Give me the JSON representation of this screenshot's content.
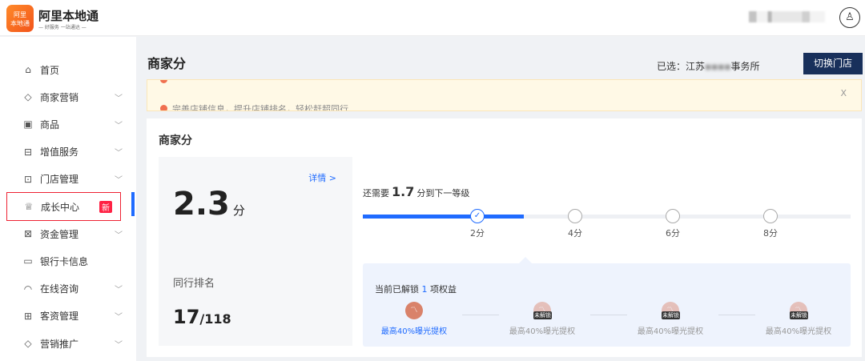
{
  "header": {
    "logo_text": "阿里本地通",
    "brand": "阿里本地通",
    "slogan": "— 好服务 一站通达 —",
    "avatar_icon": "user-icon"
  },
  "sidebar": {
    "items": [
      {
        "label": "首页",
        "icon": "⌂",
        "chev": ""
      },
      {
        "label": "商家营销",
        "icon": "◇",
        "chev": "﹀"
      },
      {
        "label": "商品",
        "icon": "▣",
        "chev": "﹀"
      },
      {
        "label": "增值服务",
        "icon": "⊟",
        "chev": "﹀"
      },
      {
        "label": "门店管理",
        "icon": "⊡",
        "chev": "﹀"
      },
      {
        "label": "成长中心",
        "icon": "♕",
        "chev": "",
        "badge": "新"
      },
      {
        "label": "资金管理",
        "icon": "⊠",
        "chev": "﹀"
      },
      {
        "label": "银行卡信息",
        "icon": "▭",
        "chev": ""
      },
      {
        "label": "在线咨询",
        "icon": "◠",
        "chev": "﹀"
      },
      {
        "label": "客资管理",
        "icon": "⊞",
        "chev": "﹀"
      },
      {
        "label": "营销推广",
        "icon": "◇",
        "chev": "﹀"
      }
    ]
  },
  "page": {
    "title": "商家分",
    "selected_label": "已选：江苏",
    "selected_suffix": "事务所",
    "switch_store": "切换门店"
  },
  "alert": {
    "line2": "完善店铺信息，提升店铺排名，轻松赶超同行",
    "close": "X"
  },
  "card": {
    "title": "商家分",
    "detail": "详情 >",
    "score": "2.3",
    "score_unit": "分",
    "rank_label": "同行排名",
    "rank": "17",
    "rank_total": "/118",
    "need_prefix": "还需要",
    "need_value": "1.7",
    "need_suffix": "分到下一等级",
    "levels": [
      "2分",
      "4分",
      "6分",
      "8分"
    ],
    "progress_fraction": 0.33,
    "unlocked_prefix": "当前已解锁",
    "unlocked_count": "1",
    "unlocked_suffix": "项权益",
    "perks": [
      {
        "label": "最高40%曝光提权",
        "locked": false
      },
      {
        "label": "最高40%曝光提权",
        "locked": true
      },
      {
        "label": "最高40%曝光提权",
        "locked": true
      },
      {
        "label": "最高40%曝光提权",
        "locked": true
      }
    ],
    "lock_label": "未解锁"
  },
  "colors": {
    "accent": "#1f6bff",
    "switch_bg": "#18305b",
    "badge": "#ff2244"
  }
}
